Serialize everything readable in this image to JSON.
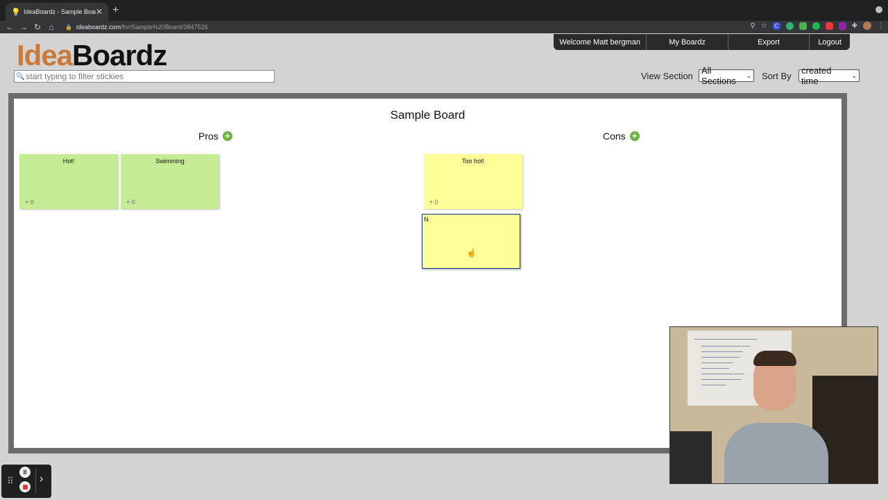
{
  "browser": {
    "tab_title": "IdeaBoardz - Sample Board",
    "url_host": "ideaboardz.com",
    "url_path": "/for/Sample%20Board/3847526"
  },
  "header": {
    "logo_part1": "Idea",
    "logo_part2": "Boardz",
    "filter_placeholder": "start typing to filter stickies",
    "nav": [
      "Welcome Matt bergman",
      "My Boardz",
      "Export",
      "Logout"
    ],
    "view_section_label": "View Section",
    "view_section_value": "All Sections",
    "sort_by_label": "Sort By",
    "sort_by_value": "created time"
  },
  "board": {
    "title": "Sample Board",
    "sections": [
      {
        "name": "Pros",
        "stickies": [
          {
            "text": "Hot!",
            "votes": "+ 0"
          },
          {
            "text": "Swimming",
            "votes": "+ 0"
          }
        ]
      },
      {
        "name": "Cons",
        "stickies": [
          {
            "text": "Too hot!",
            "votes": "+ 0"
          }
        ],
        "editing_text": "N"
      }
    ]
  },
  "colors": {
    "pros_sticky": "#c5ec95",
    "cons_sticky": "#ffff99",
    "add_button": "#6db33f"
  }
}
